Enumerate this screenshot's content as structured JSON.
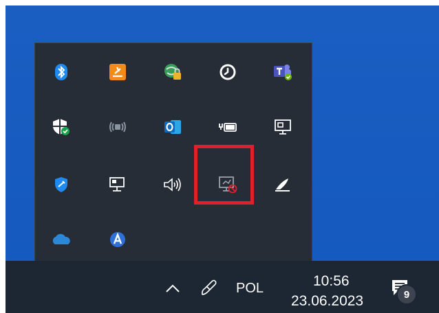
{
  "tray": {
    "icons": [
      {
        "name": "bluetooth-icon"
      },
      {
        "name": "app-orange-icon"
      },
      {
        "name": "network-lock-icon"
      },
      {
        "name": "timer-icon"
      },
      {
        "name": "teams-icon"
      },
      {
        "name": "security-shield-icon"
      },
      {
        "name": "wireless-display-icon"
      },
      {
        "name": "outlook-icon"
      },
      {
        "name": "battery-icon"
      },
      {
        "name": "network-monitor-icon"
      },
      {
        "name": "defender-icon"
      },
      {
        "name": "ethernet-icon"
      },
      {
        "name": "speaker-icon"
      },
      {
        "name": "display-disabled-icon"
      },
      {
        "name": "pen-icon"
      },
      {
        "name": "onedrive-icon"
      },
      {
        "name": "app-a-icon"
      }
    ],
    "highlight_color": "#e0202a"
  },
  "taskbar": {
    "chevron_icon": "chevron-up-icon",
    "pen_icon": "pen-input-icon",
    "language": "POL",
    "time": "10:56",
    "date": "23.06.2023",
    "notifications_count": "9"
  }
}
